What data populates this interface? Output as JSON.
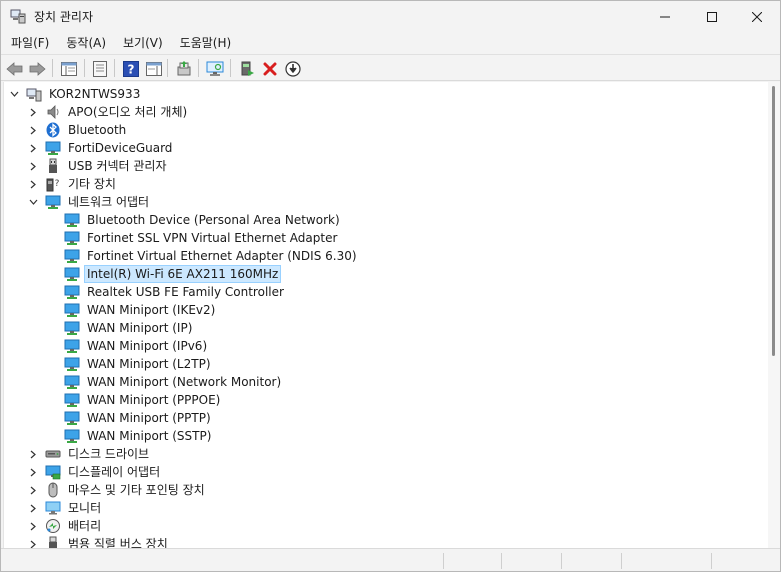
{
  "window": {
    "title": "장치 관리자"
  },
  "menu": [
    "파일(F)",
    "동작(A)",
    "보기(V)",
    "도움말(H)"
  ],
  "toolbar": {
    "buttons": [
      "back-arrow-icon",
      "forward-arrow-icon",
      "show-hide-console-tree-icon",
      "properties-icon",
      "help-icon",
      "action-pane-icon",
      "update-driver-icon",
      "scan-hardware-icon",
      "enable-device-icon",
      "uninstall-device-icon",
      "download-driver-icon"
    ]
  },
  "tree": {
    "root": "KOR2NTWS933",
    "categories": [
      {
        "label": "APO(오디오 처리 개체)",
        "icon": "speaker-icon",
        "expanded": false
      },
      {
        "label": "Bluetooth",
        "icon": "bluetooth-icon",
        "expanded": false
      },
      {
        "label": "FortiDeviceGuard",
        "icon": "monitor-icon",
        "expanded": false
      },
      {
        "label": "USB 커넥터 관리자",
        "icon": "usb-icon",
        "expanded": false
      },
      {
        "label": "기타 장치",
        "icon": "unknown-device-icon",
        "expanded": false
      },
      {
        "label": "네트워크 어댑터",
        "icon": "network-adapter-icon",
        "expanded": true,
        "children": [
          "Bluetooth Device (Personal Area Network)",
          "Fortinet SSL VPN Virtual Ethernet Adapter",
          "Fortinet Virtual Ethernet Adapter (NDIS 6.30)",
          "Intel(R) Wi-Fi 6E AX211 160MHz",
          "Realtek USB FE Family Controller",
          "WAN Miniport (IKEv2)",
          "WAN Miniport (IP)",
          "WAN Miniport (IPv6)",
          "WAN Miniport (L2TP)",
          "WAN Miniport (Network Monitor)",
          "WAN Miniport (PPPOE)",
          "WAN Miniport (PPTP)",
          "WAN Miniport (SSTP)"
        ],
        "selected_child": "Intel(R) Wi-Fi 6E AX211 160MHz"
      },
      {
        "label": "디스크 드라이브",
        "icon": "disk-drive-icon",
        "expanded": false
      },
      {
        "label": "디스플레이 어댑터",
        "icon": "display-adapter-icon",
        "expanded": false
      },
      {
        "label": "마우스 및 기타 포인팅 장치",
        "icon": "mouse-icon",
        "expanded": false
      },
      {
        "label": "모니터",
        "icon": "monitor-icon",
        "expanded": false
      },
      {
        "label": "배터리",
        "icon": "battery-icon",
        "expanded": false
      },
      {
        "label": "범용 직렬 버스 장치",
        "icon": "usb-device-icon",
        "expanded": false
      }
    ]
  },
  "colors": {
    "selection_bg": "#cce8ff",
    "selection_border": "#99d1ff",
    "delete_red": "#d81e1e",
    "help_blue": "#2b4fb4",
    "network_green": "#3aa845",
    "monitor_blue": "#2b88d8"
  }
}
